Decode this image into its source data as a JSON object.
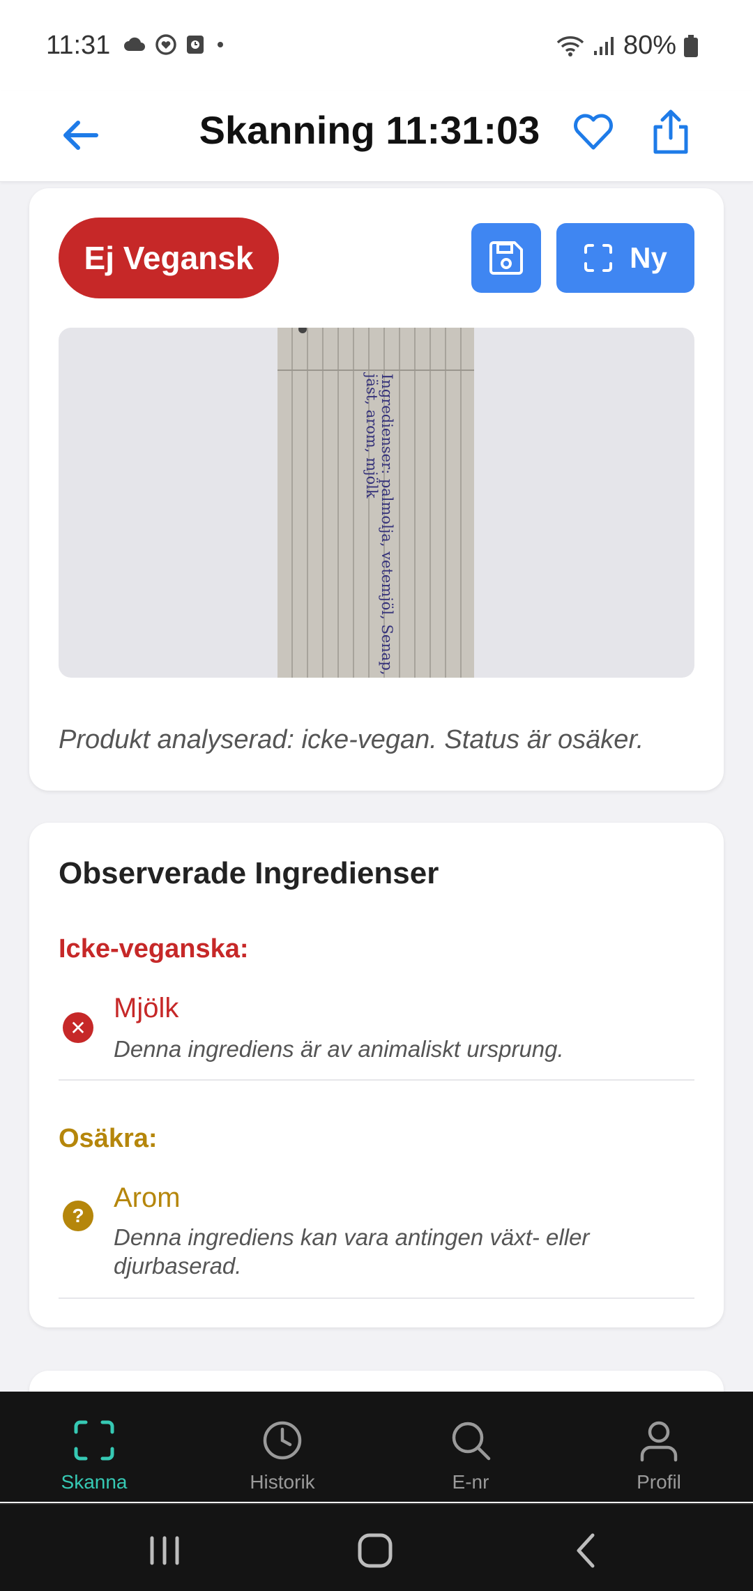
{
  "status_bar": {
    "time": "11:31",
    "battery": "80%",
    "icons": [
      "cloud-icon",
      "heart-circle-icon",
      "clock-icon",
      "dot-icon",
      "wifi-icon",
      "signal-icon",
      "battery-icon"
    ]
  },
  "header": {
    "title": "Skanning 11:31:03",
    "icons": [
      "back-arrow-icon",
      "heart-icon",
      "share-icon"
    ],
    "accent": "#1e7be8"
  },
  "result": {
    "badge": "Ej Vegansk",
    "badge_color": "#c62828",
    "new_label": "Ny",
    "button_color": "#3f86f2",
    "photo_text_line1": "Ingredienser: palmolja, vetemjöl, Senap,",
    "photo_text_line2": "jäst, arom, mjölk",
    "analysis": "Produkt analyserad: icke-vegan. Status är osäker."
  },
  "ingredients": {
    "title": "Observerade Ingredienser",
    "non_vegan_label": "Icke-veganska:",
    "uncertain_label": "Osäkra:",
    "non_vegan": [
      {
        "name": "Mjölk",
        "description": "Denna ingrediens är av animaliskt ursprung."
      }
    ],
    "uncertain": [
      {
        "name": "Arom",
        "description": "Denna ingrediens kan vara antingen växt- eller djurbaserad."
      }
    ],
    "colors": {
      "red": "#c62828",
      "amber": "#b5860b"
    }
  },
  "nav": {
    "items": [
      {
        "label": "Skanna",
        "icon": "scan-icon",
        "active": true
      },
      {
        "label": "Historik",
        "icon": "clock-icon",
        "active": false
      },
      {
        "label": "E-nr",
        "icon": "search-icon",
        "active": false
      },
      {
        "label": "Profil",
        "icon": "person-icon",
        "active": false
      }
    ],
    "active_color": "#36c9b4"
  }
}
